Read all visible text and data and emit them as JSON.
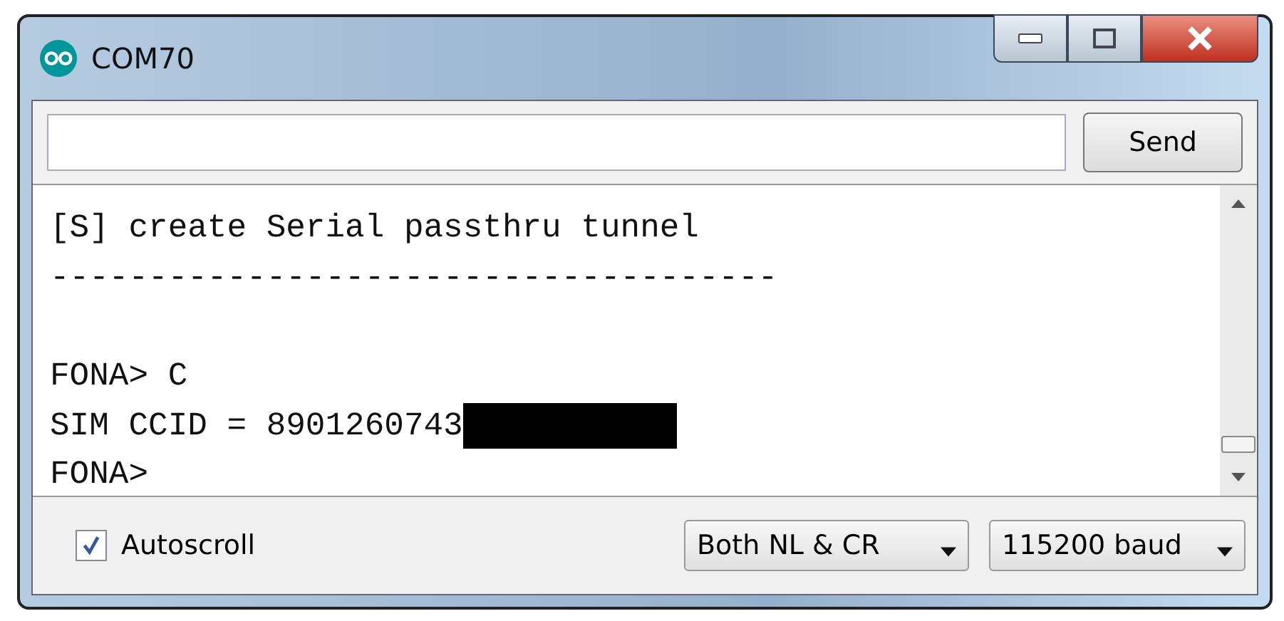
{
  "window": {
    "title": "COM70"
  },
  "send_button": "Send",
  "console_lines": [
    {
      "text": "[S] create Serial passthru tunnel",
      "redacted": false
    },
    {
      "text": "-------------------------------------",
      "redacted": false
    },
    {
      "redacted": false
    },
    {
      "text": "FONA> C",
      "redacted": false
    },
    {
      "text": "SIM CCID = 8901260743",
      "redacted": true
    },
    {
      "text": "FONA>",
      "redacted": false
    }
  ],
  "autoscroll": {
    "label": "Autoscroll",
    "checked": true
  },
  "line_ending": "Both NL & CR",
  "baud_rate": "115200 baud"
}
